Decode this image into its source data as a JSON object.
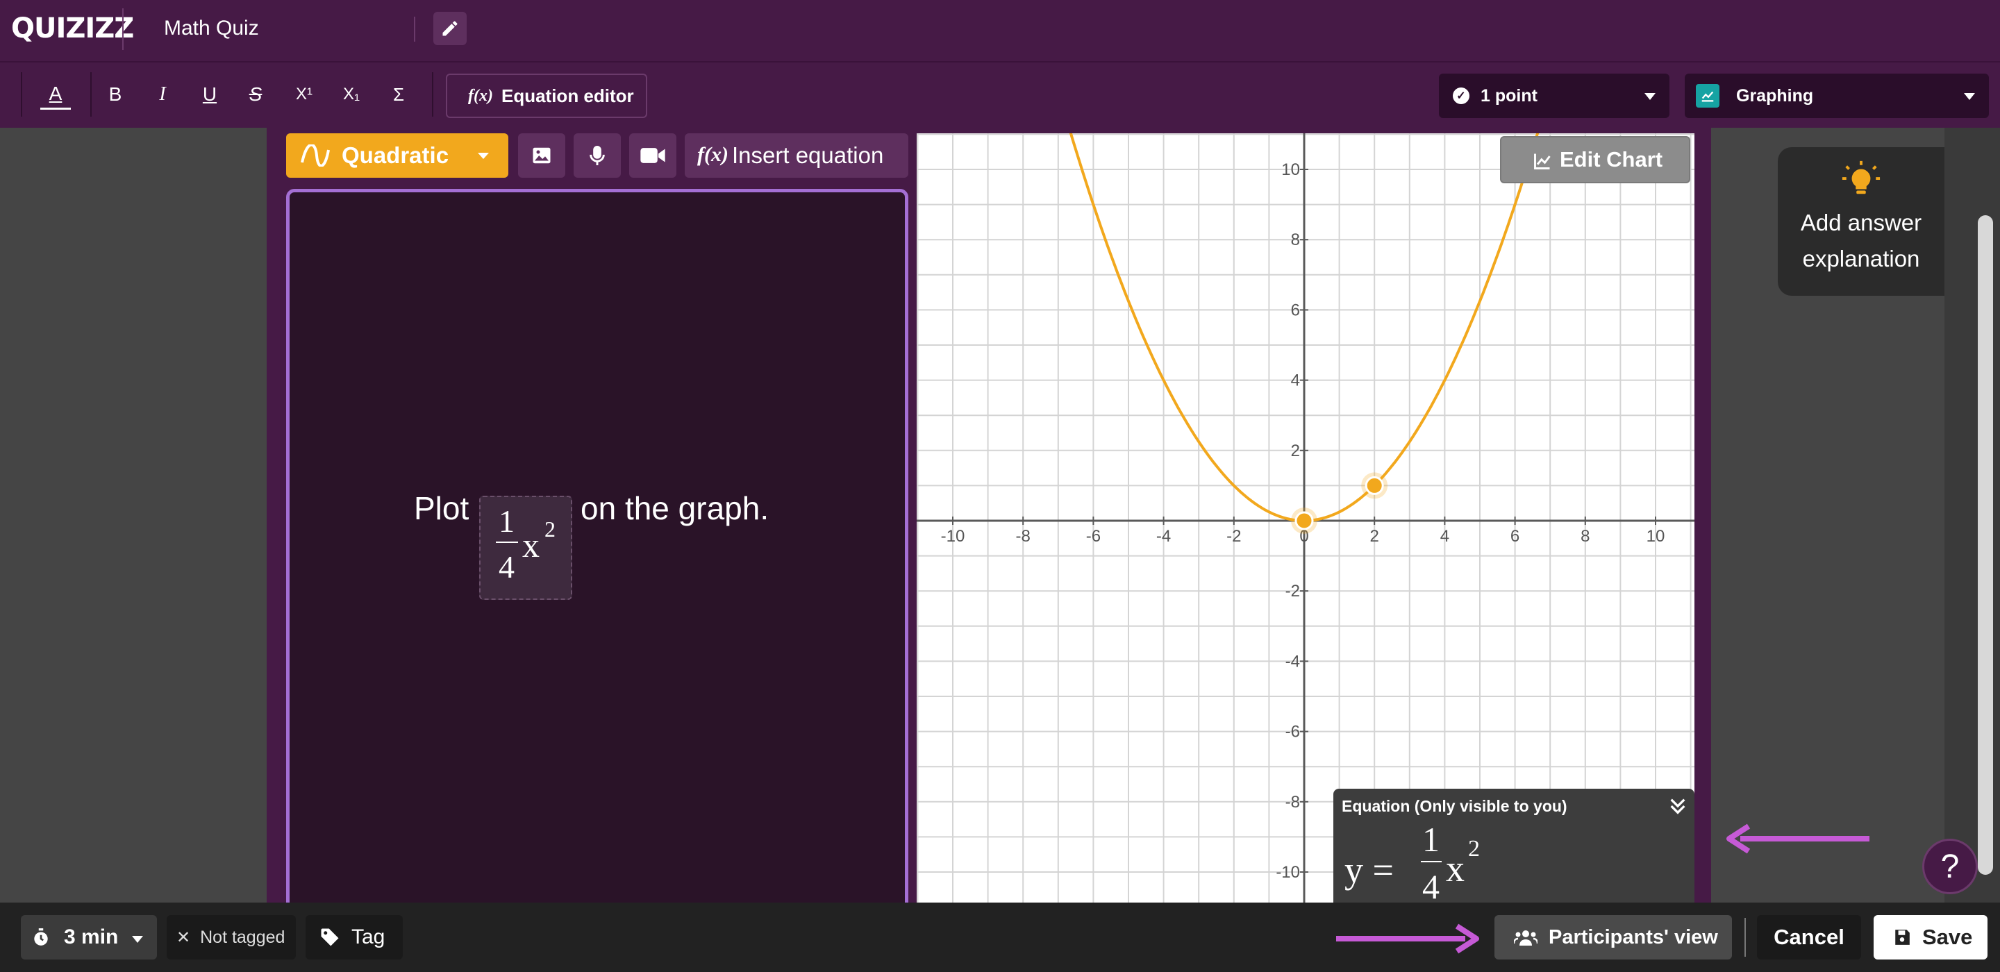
{
  "header": {
    "logo": "QUIZIZZ",
    "quiz_title": "Math Quiz"
  },
  "toolbar": {
    "format_buttons": [
      "A",
      "B",
      "I",
      "U",
      "S",
      "X¹",
      "X₁",
      "Σ"
    ],
    "equation_editor_label": "Equation editor",
    "points_label": "1 point",
    "question_type_label": "Graphing"
  },
  "question_toolbar": {
    "graph_type_label": "Quadratic",
    "insert_equation_label": "Insert equation"
  },
  "question": {
    "prefix": "Plot",
    "fraction_numerator": "1",
    "fraction_denominator": "4",
    "variable": "x",
    "exponent": "2",
    "suffix": "on the graph."
  },
  "graph": {
    "edit_chart_label": "Edit Chart",
    "x_ticks": [
      "-10",
      "-8",
      "-6",
      "-4",
      "-2",
      "0",
      "2",
      "4",
      "6",
      "8",
      "10"
    ],
    "y_ticks": [
      "10",
      "8",
      "6",
      "4",
      "2",
      "-2",
      "-4",
      "-6",
      "-8",
      "-10"
    ],
    "curve_color": "#f2a81d"
  },
  "chart_data": {
    "type": "line",
    "x_range": [
      -11,
      11
    ],
    "y_range": [
      -11,
      11
    ],
    "grid": true,
    "curve": "y = 1/4 x^2",
    "a": 0.25,
    "points": [
      {
        "x": 0,
        "y": 0
      },
      {
        "x": 2,
        "y": 1
      }
    ]
  },
  "equation_panel": {
    "title": "Equation (Only visible to you)",
    "lhs": "y =",
    "numerator": "1",
    "denominator": "4",
    "variable": "x",
    "exponent": "2"
  },
  "explanation": {
    "line1": "Add answer",
    "line2": "explanation"
  },
  "help": {
    "label": "?"
  },
  "footer": {
    "time_label": "3 min",
    "not_tagged_label": "Not tagged",
    "tag_label": "Tag",
    "participants_view_label": "Participants' view",
    "cancel_label": "Cancel",
    "save_label": "Save"
  },
  "colors": {
    "brand_purple": "#461a46",
    "accent_orange": "#f2a81d",
    "annotation_arrow": "#c65ad6"
  }
}
